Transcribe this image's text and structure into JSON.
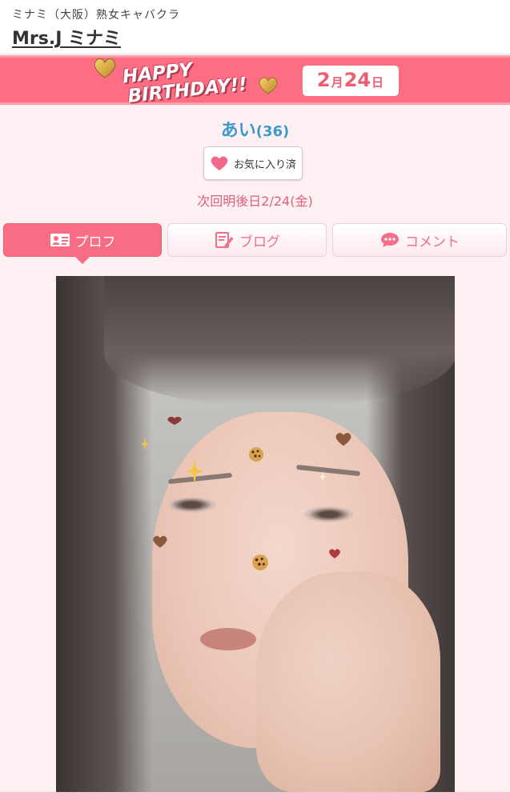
{
  "header": {
    "area_label": "ミナミ（大阪）熟女キャバクラ",
    "shop_name": "Mrs.J ミナミ"
  },
  "banner": {
    "line1": "HAPPY",
    "line2": "BIRTHDAY!!",
    "date": {
      "month": "2",
      "month_unit": "月",
      "day": "24",
      "day_unit": "日"
    },
    "colors": {
      "background": "#fe6e83",
      "date_text": "#ec5c74"
    }
  },
  "cast": {
    "name": "あい",
    "age": "(36)",
    "favorite_label": "お気に入り済",
    "next_work": "次回明後日2/24(金)"
  },
  "tabs": [
    {
      "label": "プロフ",
      "icon": "profile-card-icon",
      "active": true
    },
    {
      "label": "ブログ",
      "icon": "blog-edit-icon",
      "active": false
    },
    {
      "label": "コメント",
      "icon": "comment-bubble-icon",
      "active": false
    }
  ],
  "photo": {
    "stickers": [
      "brown-heart",
      "cookie",
      "sparkle"
    ]
  },
  "colors": {
    "accent": "#f86d84",
    "name_blue": "#3b9ccc",
    "page_pink": "#fff0f3"
  }
}
